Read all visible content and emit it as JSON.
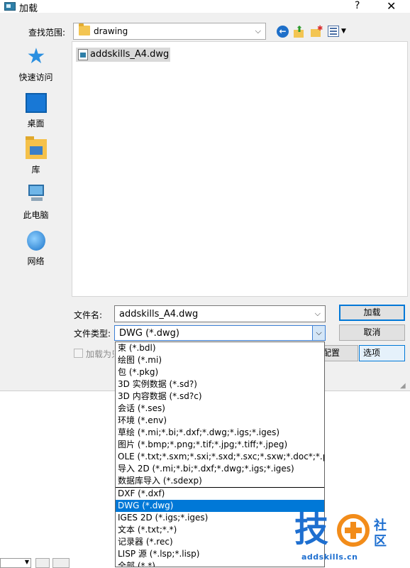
{
  "window": {
    "title": "加载",
    "help": "?",
    "close": "✕"
  },
  "lookin": {
    "label": "查找范围:",
    "value": "drawing",
    "arrow": "⌵"
  },
  "places": [
    {
      "label": "快速访问",
      "icon": "star-icon"
    },
    {
      "label": "桌面",
      "icon": "desktop-icon"
    },
    {
      "label": "库",
      "icon": "library-icon"
    },
    {
      "label": "此电脑",
      "icon": "computer-icon"
    },
    {
      "label": "网络",
      "icon": "network-icon"
    }
  ],
  "files": [
    {
      "name": "addskills_A4.dwg"
    }
  ],
  "filename": {
    "label": "文件名:",
    "value": "addskills_A4.dwg"
  },
  "filetype": {
    "label": "文件类型:",
    "value": "DWG (*.dwg)"
  },
  "checkbox": {
    "label": "加载为只读"
  },
  "buttons": {
    "open": "加载",
    "cancel": "取消",
    "config": "配置",
    "options": "选项"
  },
  "dropdown": [
    "束 (*.bdl)",
    "绘图 (*.mi)",
    "包 (*.pkg)",
    "3D 实例数据 (*.sd?)",
    "3D 内容数据 (*.sd?c)",
    "会话 (*.ses)",
    "环境 (*.env)",
    "草绘 (*.mi;*.bi;*.dxf;*.dwg;*.igs;*.iges)",
    "图片 (*.bmp;*.png;*.tif;*.jpg;*.tiff;*.jpeg)",
    "OLE (*.txt;*.sxm;*.sxi;*.sxd;*.sxc;*.sxw;*.doc*;*.ppt*",
    "导入 2D (*.mi;*.bi;*.dxf;*.dwg;*.igs;*.iges)",
    "数据库导入 (*.sdexp)",
    "DXF (*.dxf)",
    "DWG (*.dwg)",
    "IGES 2D (*.igs;*.iges)",
    "文本 (*.txt;*.*)",
    "记录器 (*.rec)",
    "LISP 源 (*.lsp;*.lisp)",
    "全部 (*.*)"
  ],
  "watermark": {
    "char": "技",
    "t1": "社",
    "t2": "区",
    "url": "addskills.cn"
  }
}
